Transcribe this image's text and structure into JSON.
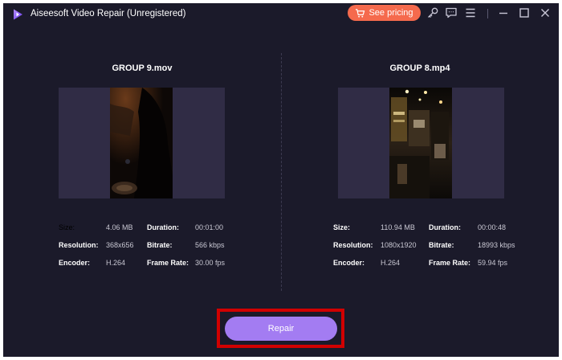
{
  "window": {
    "title": "Aiseesoft Video Repair (Unregistered)",
    "pricing_label": "See pricing",
    "icons": [
      "key-icon",
      "feedback-icon",
      "menu-icon",
      "minimize-icon",
      "maximize-icon",
      "close-icon"
    ]
  },
  "left": {
    "file_name": "GROUP 9.mov",
    "size_label": "Size:",
    "size_value": "4.06 MB",
    "duration_label": "Duration:",
    "duration_value": "00:01:00",
    "resolution_label": "Resolution:",
    "resolution_value": "368x656",
    "bitrate_label": "Bitrate:",
    "bitrate_value": "566 kbps",
    "encoder_label": "Encoder:",
    "encoder_value": "H.264",
    "framerate_label": "Frame Rate:",
    "framerate_value": "30.00 fps"
  },
  "right": {
    "file_name": "GROUP 8.mp4",
    "size_label": "Size:",
    "size_value": "110.94 MB",
    "duration_label": "Duration:",
    "duration_value": "00:00:48",
    "resolution_label": "Resolution:",
    "resolution_value": "1080x1920",
    "bitrate_label": "Bitrate:",
    "bitrate_value": "18993 kbps",
    "encoder_label": "Encoder:",
    "encoder_value": "H.264",
    "framerate_label": "Frame Rate:",
    "framerate_value": "59.94 fps"
  },
  "repair": {
    "label": "Repair"
  },
  "colors": {
    "background": "#1b1a2a",
    "preview": "#302c45",
    "pricing": "#f56a4d",
    "repair": "#a37cf2",
    "highlight": "#d10000"
  }
}
